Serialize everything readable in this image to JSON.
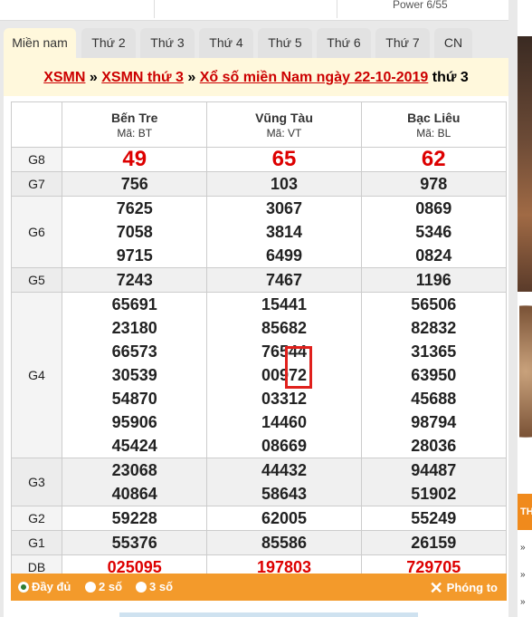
{
  "top": {
    "power_label": "Power 6/55"
  },
  "tabs": [
    {
      "label": "Miền nam",
      "active": true
    },
    {
      "label": "Thứ 2"
    },
    {
      "label": "Thứ 3"
    },
    {
      "label": "Thứ 4"
    },
    {
      "label": "Thứ 5"
    },
    {
      "label": "Thứ 6"
    },
    {
      "label": "Thứ 7"
    },
    {
      "label": "CN"
    }
  ],
  "breadcrumb": {
    "link1": "XSMN",
    "sep1": " » ",
    "link2": "XSMN thứ 3",
    "sep2": " » ",
    "link3": "Xổ số miền Nam ngày 22-10-2019",
    "tail": " thứ 3"
  },
  "provinces": [
    {
      "name": "Bến Tre",
      "code": "Mã: BT"
    },
    {
      "name": "Vũng Tàu",
      "code": "Mã: VT"
    },
    {
      "name": "Bạc Liêu",
      "code": "Mã: BL"
    }
  ],
  "prizes": {
    "G8": {
      "label": "G8",
      "values": [
        [
          "49"
        ],
        [
          "65"
        ],
        [
          "62"
        ]
      ]
    },
    "G7": {
      "label": "G7",
      "values": [
        [
          "756"
        ],
        [
          "103"
        ],
        [
          "978"
        ]
      ]
    },
    "G6": {
      "label": "G6",
      "values": [
        [
          "7625",
          "7058",
          "9715"
        ],
        [
          "3067",
          "3814",
          "6499"
        ],
        [
          "0869",
          "5346",
          "0824"
        ]
      ]
    },
    "G5": {
      "label": "G5",
      "values": [
        [
          "7243"
        ],
        [
          "7467"
        ],
        [
          "1196"
        ]
      ]
    },
    "G4": {
      "label": "G4",
      "values": [
        [
          "65691",
          "23180",
          "66573",
          "30539",
          "54870",
          "95906",
          "45424"
        ],
        [
          "15441",
          "85682",
          "76544",
          "00972",
          "03312",
          "14460",
          "08669"
        ],
        [
          "56506",
          "82832",
          "31365",
          "63950",
          "45688",
          "98794",
          "28036"
        ]
      ]
    },
    "G3": {
      "label": "G3",
      "values": [
        [
          "23068",
          "40864"
        ],
        [
          "44432",
          "58643"
        ],
        [
          "94487",
          "51902"
        ]
      ]
    },
    "G2": {
      "label": "G2",
      "values": [
        [
          "59228"
        ],
        [
          "62005"
        ],
        [
          "55249"
        ]
      ]
    },
    "G1": {
      "label": "G1",
      "values": [
        [
          "55376"
        ],
        [
          "85586"
        ],
        [
          "26159"
        ]
      ]
    },
    "DB": {
      "label": "DB",
      "values": [
        [
          "025095"
        ],
        [
          "197803"
        ],
        [
          "729705"
        ]
      ]
    }
  },
  "footer": {
    "opt1": "Đầy đủ",
    "opt2": "2 số",
    "opt3": "3 số",
    "zoom": "Phóng to"
  },
  "side": {
    "bar_label": "TH"
  },
  "colors": {
    "accent": "#f39a2b",
    "link": "#cc0000",
    "special": "#dd0000"
  }
}
